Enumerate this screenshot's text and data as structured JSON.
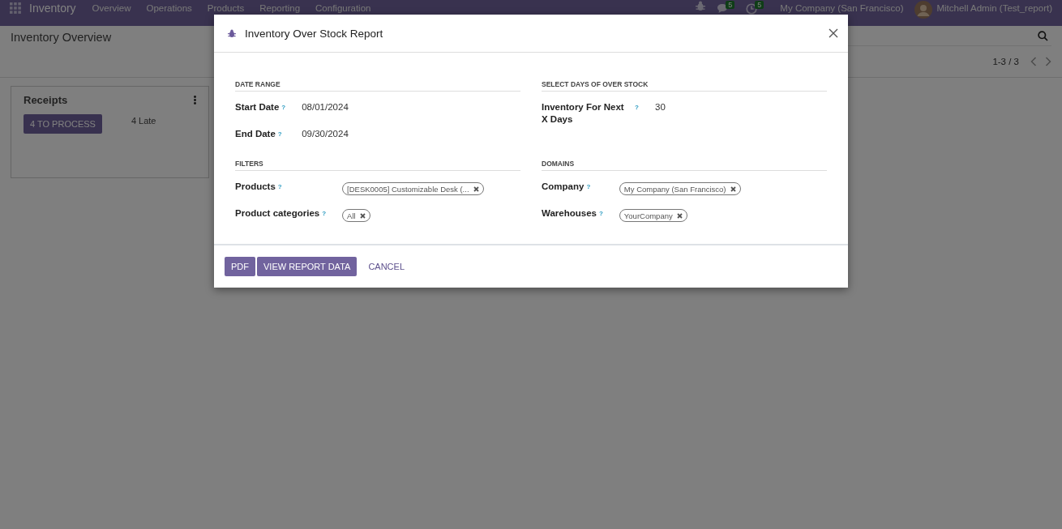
{
  "navbar": {
    "app": "Inventory",
    "menus": [
      "Overview",
      "Operations",
      "Products",
      "Reporting",
      "Configuration"
    ],
    "chat_count": "5",
    "activity_count": "5",
    "company": "My Company (San Francisco)",
    "user": "Mitchell Admin (Test_report)"
  },
  "control_panel": {
    "title": "Inventory Overview",
    "pager": "1-3 / 3"
  },
  "cards": [
    {
      "title": "Receipts",
      "button": "4 TO PROCESS",
      "late": "4 Late"
    }
  ],
  "dialog": {
    "title": "Inventory Over Stock Report",
    "sections": [
      {
        "title": "DATE RANGE",
        "fields": [
          {
            "label": "Start Date",
            "help": "?",
            "kind": "text",
            "value": "08/01/2024"
          },
          {
            "label": "End Date",
            "help": "?",
            "kind": "text",
            "value": "09/30/2024"
          }
        ]
      },
      {
        "title": "SELECT DAYS OF OVER STOCK",
        "fields": [
          {
            "label": "Inventory For Next X Days",
            "help": "?",
            "kind": "text",
            "value": "30"
          }
        ]
      },
      {
        "title": "FILTERS",
        "fields": [
          {
            "label": "Products",
            "help": "?",
            "kind": "tags",
            "tags": [
              "[DESK0005] Customizable Desk (..."
            ]
          },
          {
            "label": "Product categories",
            "help": "?",
            "kind": "tags",
            "tags": [
              "All"
            ]
          }
        ]
      },
      {
        "title": "DOMAINS",
        "fields": [
          {
            "label": "Company",
            "help": "?",
            "kind": "tags",
            "tags": [
              "My Company (San Francisco)"
            ]
          },
          {
            "label": "Warehouses",
            "help": "?",
            "kind": "tags",
            "tags": [
              "YourCompany"
            ]
          }
        ]
      }
    ],
    "buttons": [
      {
        "label": "PDF",
        "kind": "primary"
      },
      {
        "label": "VIEW REPORT DATA",
        "kind": "primary"
      },
      {
        "label": "CANCEL",
        "kind": "link"
      }
    ]
  }
}
